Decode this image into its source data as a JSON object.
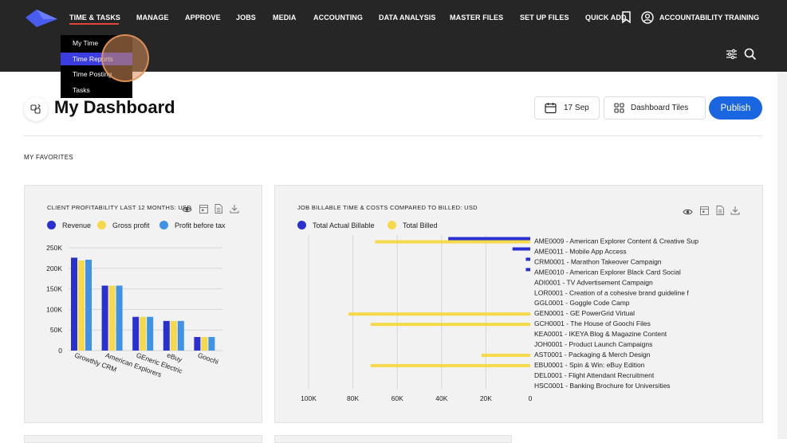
{
  "header": {
    "nav_items": [
      "TIME & TASKS",
      "MANAGE",
      "APPROVE",
      "JOBS",
      "MEDIA",
      "ACCOUNTING",
      "DATA ANALYSIS",
      "MASTER FILES",
      "SET UP FILES",
      "QUICK ADD"
    ],
    "user_label": "ACCOUNTABILITY TRAINING",
    "colors": {
      "bar": "#262626",
      "active_underline": "#e0463a",
      "logo": "#4a5cf0"
    }
  },
  "dropdown": {
    "items": [
      "My Time",
      "Time Reports",
      "Time Posting",
      "Tasks"
    ],
    "active_item": "Time Reports"
  },
  "page": {
    "title": "My Dashboard",
    "date_label": "17 Sep",
    "tiles_label": "Dashboard Tiles",
    "publish_label": "Publish",
    "favorites_label": "MY FAVORITES"
  },
  "card1": {
    "title": "CLIENT PROFITABILITY LAST 12 MONTHS: USD",
    "legend": [
      "Revenue",
      "Gross profit",
      "Profit before tax"
    ]
  },
  "card2": {
    "title": "JOB BILLABLE TIME & COSTS COMPARED TO BILLED: USD",
    "legend": [
      "Total Actual Billable",
      "Total Billed"
    ]
  },
  "chart_data": [
    {
      "type": "bar",
      "title": "CLIENT PROFITABILITY LAST 12 MONTHS: USD",
      "categories": [
        "Growthly CRM",
        "American Explorers",
        "GEneric Electric",
        "eBuy",
        "Goochi"
      ],
      "series": [
        {
          "name": "Revenue",
          "color": "#2a2fd0",
          "values": [
            226000,
            158000,
            82000,
            72000,
            33000
          ]
        },
        {
          "name": "Gross profit",
          "color": "#f5d94a",
          "values": [
            219000,
            158000,
            82000,
            72000,
            33000
          ]
        },
        {
          "name": "Profit before tax",
          "color": "#3f93e6",
          "values": [
            221000,
            158000,
            82000,
            72000,
            33000
          ]
        }
      ],
      "y_ticks": [
        "250K",
        "200K",
        "150K",
        "100K",
        "50K",
        "0"
      ],
      "ylim": [
        0,
        250000
      ],
      "grid": true
    },
    {
      "type": "bar",
      "orientation": "horizontal",
      "title": "JOB BILLABLE TIME & COSTS COMPARED TO BILLED: USD",
      "categories": [
        "AME0009 - American Explorer Content & Creative Sup",
        "AME0011 - Mobile App Access",
        "CRM0001 - Marathon Takeover Campaign",
        "AME0010 - American Explorer Black Card Social",
        "ADI0001 - TV Advertisement Campaign",
        "LOR0001 - Creation of a cohesive brand guideline f",
        "GGL0001 - Goggle Code Camp",
        "GEN0001 - GE PowerGrid Virtual",
        "GCH0001 - The House of Goochi Files",
        "KEA0001 - IKEYA Blog & Magazine Content",
        "JOH0001 - Product Launch Campaigns",
        "AST0001 - Packaging & Merch Design",
        "EBU0001 - Spin & Win: eBuy Edition",
        "DEL0001 - Flight Attendant Recruitment",
        "HSC0001 - Banking Brochure for Universities"
      ],
      "series": [
        {
          "name": "Total Actual Billable",
          "color": "#2a2fd0",
          "values": [
            37000,
            8000,
            2000,
            2000,
            0,
            0,
            0,
            0,
            0,
            0,
            0,
            0,
            0,
            0,
            0
          ]
        },
        {
          "name": "Total Billed",
          "color": "#f5d94a",
          "values": [
            70000,
            0,
            0,
            0,
            0,
            0,
            0,
            82000,
            72000,
            0,
            0,
            22000,
            72000,
            0,
            0
          ]
        }
      ],
      "x_ticks": [
        "100K",
        "80K",
        "60K",
        "40K",
        "20K",
        "0"
      ],
      "xlim": [
        100000,
        0
      ],
      "grid": true
    }
  ]
}
